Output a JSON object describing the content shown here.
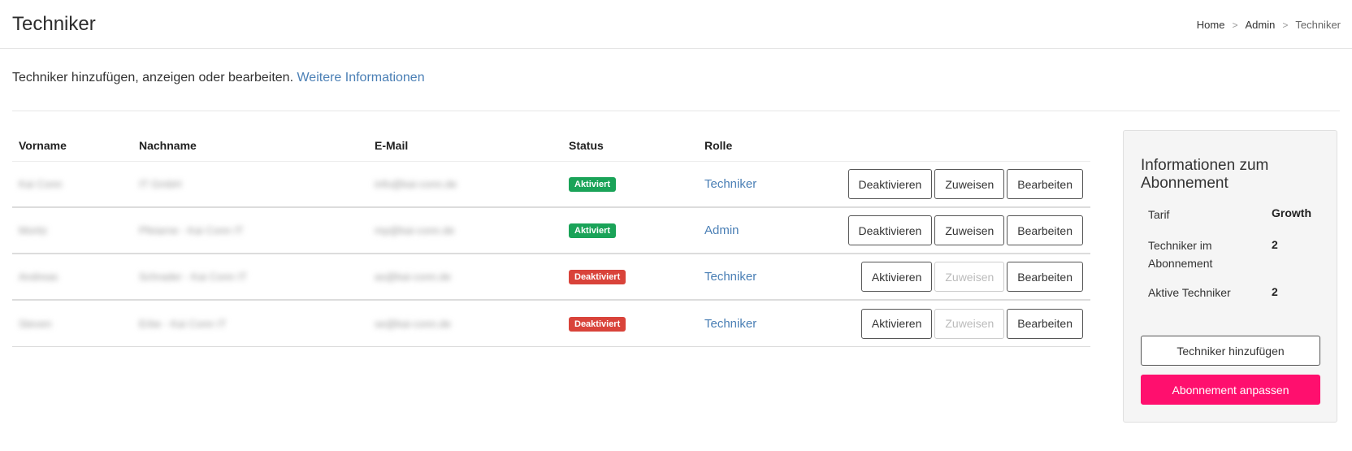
{
  "header": {
    "title": "Techniker",
    "breadcrumb": [
      "Home",
      "Admin",
      "Techniker"
    ],
    "separator": ">"
  },
  "intro": {
    "text": "Techniker hinzufügen, anzeigen oder bearbeiten.",
    "link": "Weitere Informationen"
  },
  "table": {
    "columns": [
      "Vorname",
      "Nachname",
      "E-Mail",
      "Status",
      "Rolle"
    ],
    "rows": [
      {
        "vorname": "Kai Conn",
        "nachname": "IT GmbH",
        "email": "info@kai-conn.de",
        "status": "Aktiviert",
        "status_color": "#1aa358",
        "rolle": "Techniker",
        "toggle_label": "Deaktivieren",
        "assign_label": "Zuweisen",
        "assign_enabled": true,
        "edit_label": "Bearbeiten"
      },
      {
        "vorname": "Moritz",
        "nachname": "Pfeiarne - Kai Conn IT",
        "email": "mp@kai-conn.de",
        "status": "Aktiviert",
        "status_color": "#1aa358",
        "rolle": "Admin",
        "toggle_label": "Deaktivieren",
        "assign_label": "Zuweisen",
        "assign_enabled": true,
        "edit_label": "Bearbeiten"
      },
      {
        "vorname": "Andreas",
        "nachname": "Schrader - Kai Conn IT",
        "email": "as@kai-conn.de",
        "status": "Deaktiviert",
        "status_color": "#d9433a",
        "rolle": "Techniker",
        "toggle_label": "Aktivieren",
        "assign_label": "Zuweisen",
        "assign_enabled": false,
        "edit_label": "Bearbeiten"
      },
      {
        "vorname": "Steven",
        "nachname": "Erbe - Kai Conn IT",
        "email": "se@kai-conn.de",
        "status": "Deaktiviert",
        "status_color": "#d9433a",
        "rolle": "Techniker",
        "toggle_label": "Aktivieren",
        "assign_label": "Zuweisen",
        "assign_enabled": false,
        "edit_label": "Bearbeiten"
      }
    ]
  },
  "panel": {
    "title": "Informationen zum Abonnement",
    "rows": [
      {
        "label": "Tarif",
        "value": "Growth"
      },
      {
        "label": "Techniker im Abonnement",
        "value": "2"
      },
      {
        "label": "Aktive Techniker",
        "value": "2"
      }
    ],
    "add_button": "Techniker hinzufügen",
    "adjust_button": "Abonnement anpassen",
    "accent_color": "#ff0f6e"
  },
  "colors": {
    "link": "#4a7fb5",
    "active": "#1aa358",
    "inactive": "#d9433a"
  }
}
